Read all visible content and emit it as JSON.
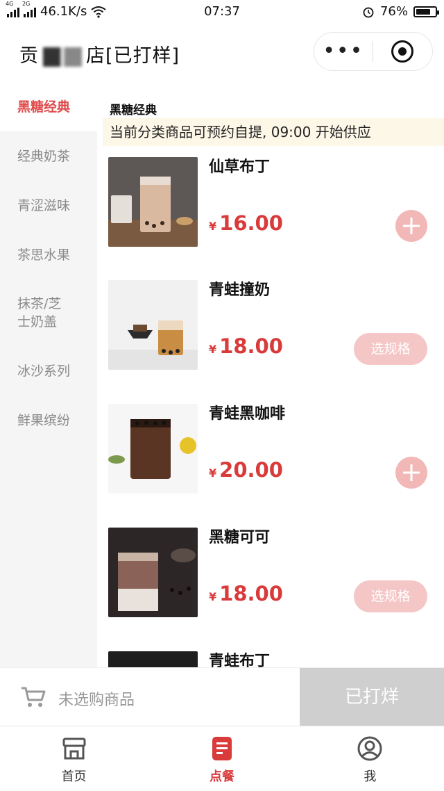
{
  "status_bar": {
    "network_tag_1": "4G",
    "network_tag_2": "2G",
    "speed": "46.1K/s",
    "time": "07:37",
    "battery": "76%",
    "battery_level": 0.76
  },
  "header": {
    "title_prefix": "贡",
    "title_suffix": "店[已打样]"
  },
  "sidebar": {
    "items": [
      {
        "label": "黑糖经典"
      },
      {
        "label": "经典奶茶"
      },
      {
        "label": "青涩滋味"
      },
      {
        "label": "茶思水果"
      },
      {
        "label": "抹茶/芝\n士奶盖"
      },
      {
        "label": "冰沙系列"
      },
      {
        "label": "鲜果缤纷"
      }
    ]
  },
  "main": {
    "category_title": "黑糖经典",
    "notice": "当前分类商品可预约自提, 09:00 开始供应",
    "currency": "¥",
    "spec_label": "选规格",
    "products": [
      {
        "name": "仙草布丁",
        "price": "16.00"
      },
      {
        "name": "青蛙撞奶",
        "price": "18.00"
      },
      {
        "name": "青蛙黑咖啡",
        "price": "20.00"
      },
      {
        "name": "黑糖可可",
        "price": "18.00"
      },
      {
        "name": "青蛙布丁"
      }
    ]
  },
  "cart": {
    "empty_text": "未选购商品",
    "button_label": "已打烊"
  },
  "tabbar": {
    "tabs": [
      {
        "label": "首页"
      },
      {
        "label": "点餐"
      },
      {
        "label": "我"
      }
    ]
  },
  "colors": {
    "accent": "#d93a3a",
    "button_disabled": "#cfcfcf",
    "notice_bg": "#fdf7e8"
  }
}
